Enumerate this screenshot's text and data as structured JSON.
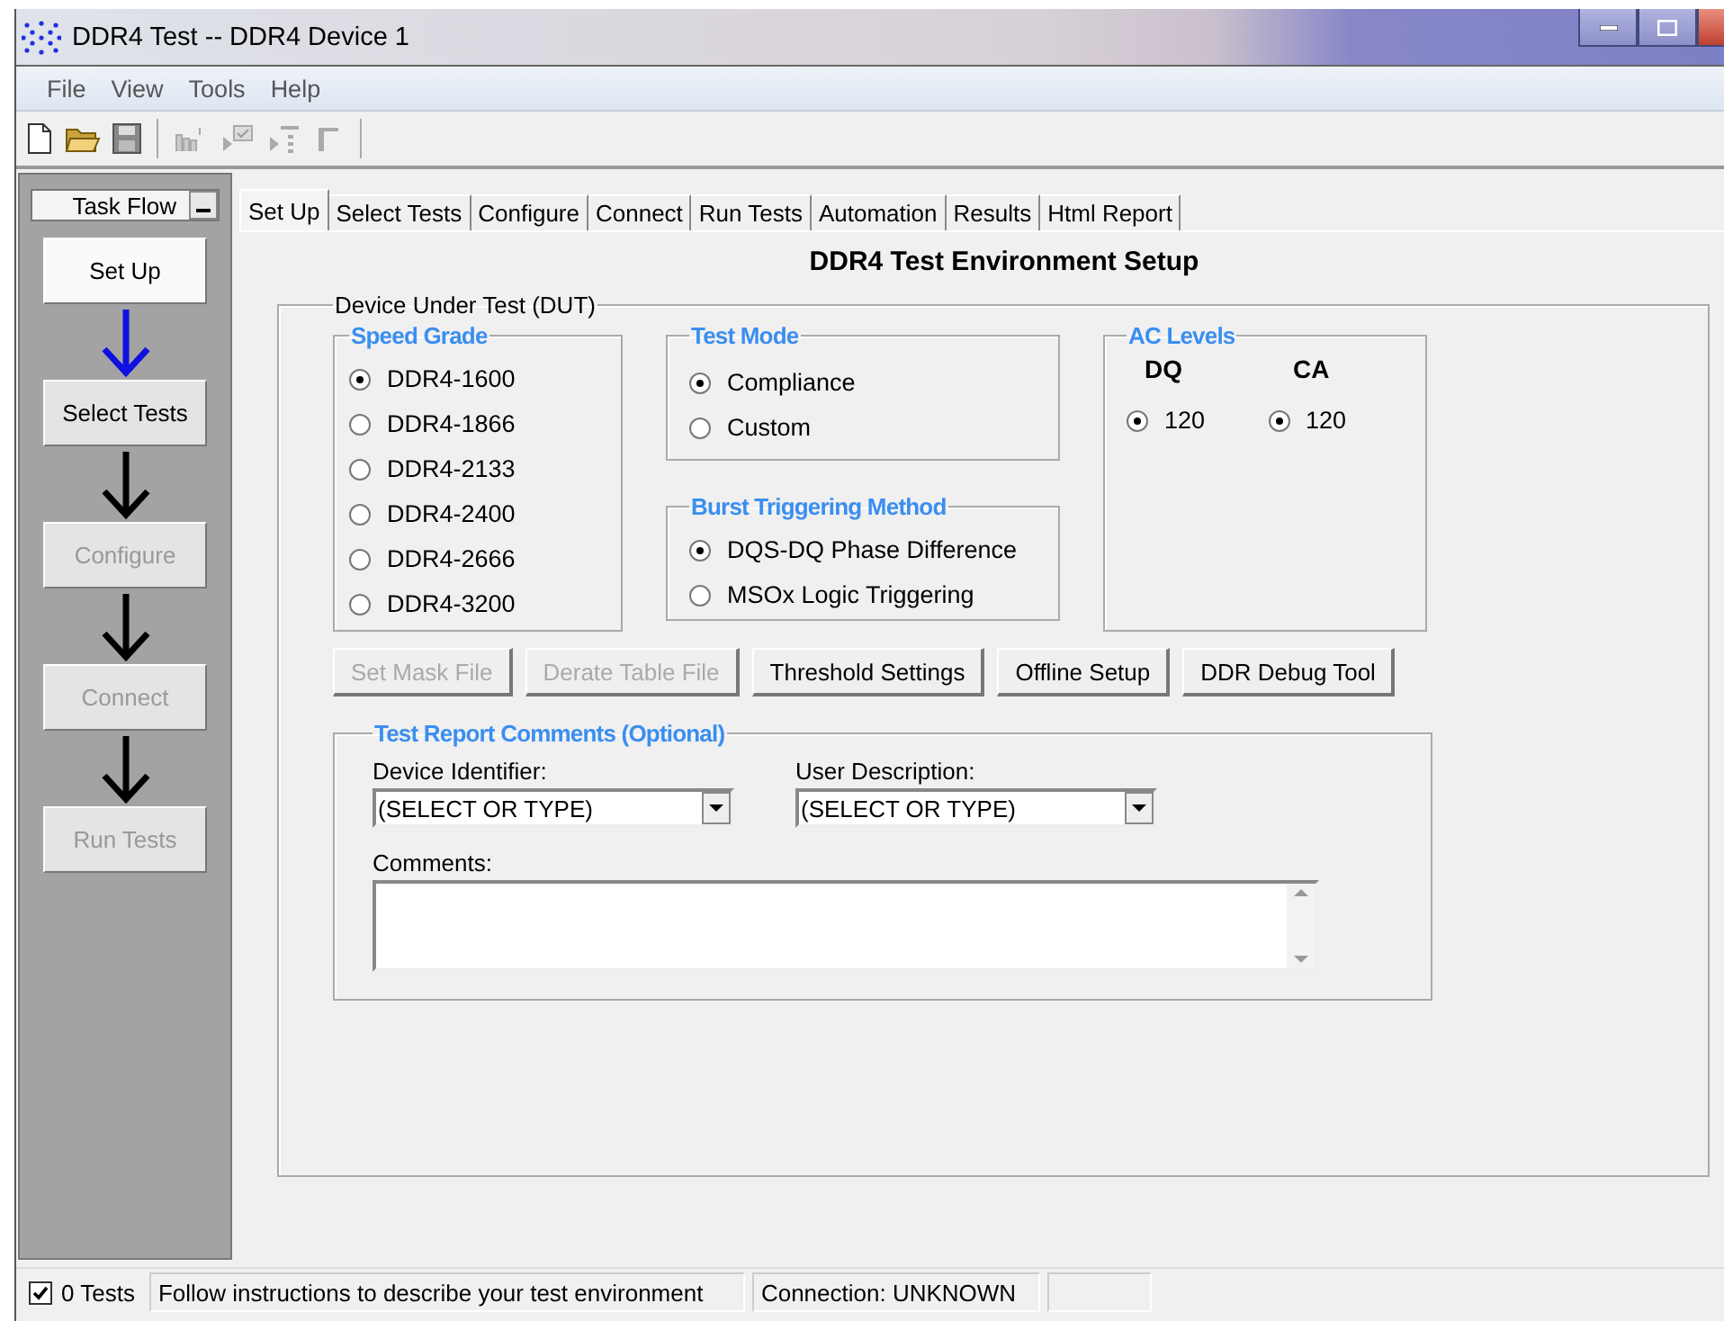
{
  "window": {
    "title": "DDR4 Test -- DDR4 Device 1"
  },
  "menu": [
    {
      "label": "File"
    },
    {
      "label": "View"
    },
    {
      "label": "Tools"
    },
    {
      "label": "Help"
    }
  ],
  "task_flow": {
    "title": "Task Flow",
    "steps": [
      {
        "label": "Set Up",
        "selected": true,
        "disabled": false
      },
      {
        "label": "Select Tests",
        "selected": false,
        "disabled": false
      },
      {
        "label": "Configure",
        "selected": false,
        "disabled": true
      },
      {
        "label": "Connect",
        "selected": false,
        "disabled": true
      },
      {
        "label": "Run Tests",
        "selected": false,
        "disabled": true
      }
    ]
  },
  "tabs": [
    {
      "label": "Set Up",
      "selected": true
    },
    {
      "label": "Select Tests",
      "selected": false
    },
    {
      "label": "Configure",
      "selected": false
    },
    {
      "label": "Connect",
      "selected": false
    },
    {
      "label": "Run Tests",
      "selected": false
    },
    {
      "label": "Automation",
      "selected": false
    },
    {
      "label": "Results",
      "selected": false
    },
    {
      "label": "Html Report",
      "selected": false
    }
  ],
  "page_title": "DDR4 Test Environment Setup",
  "dut": {
    "title": "Device Under Test (DUT)",
    "speed_grade": {
      "title": "Speed Grade",
      "options": [
        {
          "label": "DDR4-1600",
          "selected": true
        },
        {
          "label": "DDR4-1866",
          "selected": false
        },
        {
          "label": "DDR4-2133",
          "selected": false
        },
        {
          "label": "DDR4-2400",
          "selected": false
        },
        {
          "label": "DDR4-2666",
          "selected": false
        },
        {
          "label": "DDR4-3200",
          "selected": false
        }
      ]
    },
    "test_mode": {
      "title": "Test Mode",
      "options": [
        {
          "label": "Compliance",
          "selected": true
        },
        {
          "label": "Custom",
          "selected": false
        }
      ]
    },
    "burst_triggering": {
      "title": "Burst Triggering Method",
      "options": [
        {
          "label": "DQS-DQ Phase Difference",
          "selected": true
        },
        {
          "label": "MSOx Logic Triggering",
          "selected": false
        }
      ]
    },
    "ac_levels": {
      "title": "AC Levels",
      "columns": [
        {
          "heading": "DQ",
          "options": [
            {
              "label": "120",
              "selected": true
            }
          ]
        },
        {
          "heading": "CA",
          "options": [
            {
              "label": "120",
              "selected": true
            }
          ]
        }
      ]
    }
  },
  "buttons": [
    {
      "label": "Set Mask File",
      "disabled": true
    },
    {
      "label": "Derate Table File",
      "disabled": true
    },
    {
      "label": "Threshold Settings",
      "disabled": false
    },
    {
      "label": "Offline Setup",
      "disabled": false
    },
    {
      "label": "DDR Debug Tool",
      "disabled": false
    }
  ],
  "comments": {
    "title": "Test Report Comments (Optional)",
    "device_identifier": {
      "label": "Device Identifier:",
      "value": "(SELECT OR TYPE)"
    },
    "user_description": {
      "label": "User Description:",
      "value": "(SELECT OR TYPE)"
    },
    "comments": {
      "label": "Comments:"
    }
  },
  "status_bar": {
    "tests": {
      "checked": true,
      "label": "0 Tests"
    },
    "message": "Follow instructions to describe your test environment",
    "connection": "Connection: UNKNOWN"
  }
}
